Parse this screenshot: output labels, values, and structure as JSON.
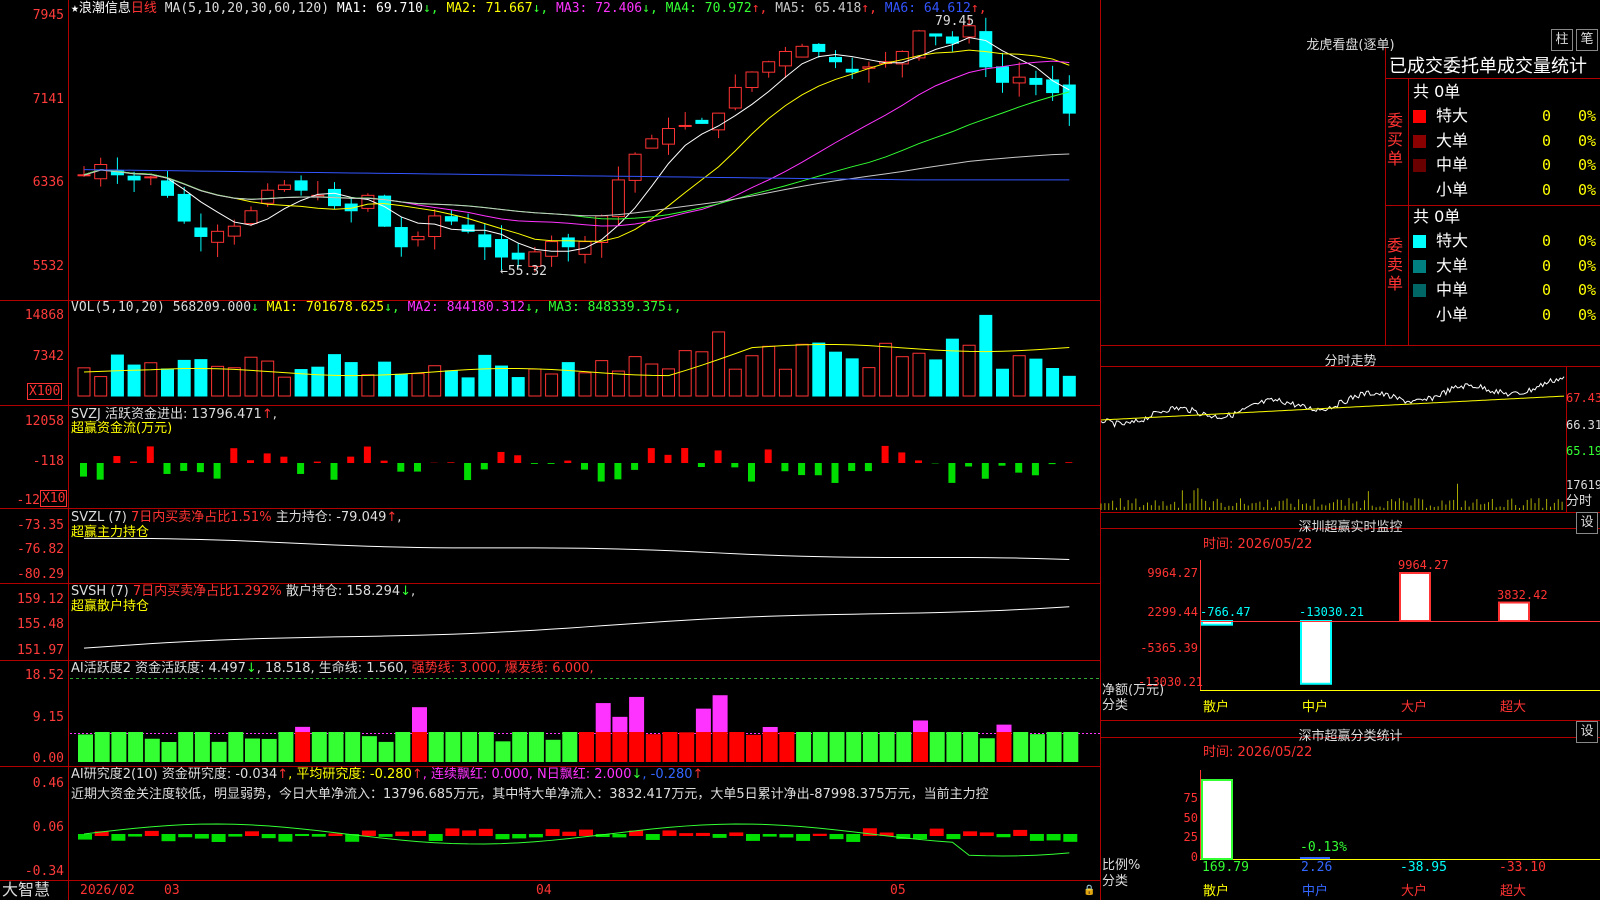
{
  "stock": {
    "star": "★",
    "name": "浪潮信息",
    "period": "日线"
  },
  "ma_header": {
    "spec": "MA(5,10,20,30,60,120)",
    "items": [
      {
        "label": "MA1:",
        "value": "69.710",
        "arrow": "↓",
        "color": "#ffffff"
      },
      {
        "label": "MA2:",
        "value": "71.667",
        "arrow": "↓",
        "color": "#ffff00"
      },
      {
        "label": "MA3:",
        "value": "72.406",
        "arrow": "↓",
        "color": "#ff33ff"
      },
      {
        "label": "MA4:",
        "value": "70.972",
        "arrow": "↑",
        "color": "#33ff33"
      },
      {
        "label": "MA5:",
        "value": "65.418",
        "arrow": "↑",
        "color": "#c8c8c8"
      },
      {
        "label": "MA6:",
        "value": "64.612",
        "arrow": "↑",
        "color": "#3355ff"
      }
    ]
  },
  "price_axis": [
    "7945",
    "7141",
    "6336",
    "5532"
  ],
  "price_high_label": "79.45",
  "price_low_label": "←55.32",
  "vol_header": {
    "spec": "VOL(5,10,20)",
    "value": "568209.000",
    "arrow": "↓",
    "items": [
      {
        "label": "MA1:",
        "value": "701678.625",
        "arrow": "↓",
        "color": "#ffff00"
      },
      {
        "label": "MA2:",
        "value": "844180.312",
        "arrow": "↓",
        "color": "#ff33ff"
      },
      {
        "label": "MA3:",
        "value": "848339.375",
        "arrow": "↓",
        "color": "#33ff33"
      }
    ]
  },
  "vol_axis": [
    "14868",
    "7342"
  ],
  "vol_unit": "X100",
  "svzj": {
    "line1": "SVZJ  活跃资金进出: 13796.471",
    "arrow": "↑",
    "tail": ",",
    "line2": "超赢资金流(万元)"
  },
  "svzj_axis": [
    "12058",
    "-118",
    "-12"
  ],
  "svzj_unit": "X10",
  "svzl": {
    "prefix": "SVZL (7) ",
    "red": "7日内买卖净占比1.51%",
    "mid": " 主力持仓: -79.049",
    "arrow": "↑",
    "tail": ",",
    "line2": "超赢主力持仓"
  },
  "svzl_axis": [
    "-73.35",
    "-76.82",
    "-80.29"
  ],
  "svsh": {
    "prefix": "SVSH (7) ",
    "red": "7日内买卖净占比1.292%",
    "mid": " 散户持仓: 158.294",
    "arrow": "↓",
    "tail": ",",
    "line2": "超赢散户持仓"
  },
  "svsh_axis": [
    "159.12",
    "155.48",
    "151.97"
  ],
  "ai1": {
    "prefix": "AI活跃度2 资金活跃度: 4.497",
    "a1": "↓",
    "mid": ", 18.518, 生命线: 1.560,",
    "red": " 强势线: 3.000, 爆发线: 6.000,"
  },
  "ai1_axis": [
    "18.52",
    "9.15",
    "0.00"
  ],
  "ai2": {
    "prefix": "AI研究度2(10) 资金研究度: -0.034",
    "a1": "↑",
    "avg": ", 平均研究度: -0.280",
    "a2": "↑",
    "red": ", 连续飘红: 0.000, N日飘红: 2.000",
    "a3": "↓",
    "blue": ", -0.280",
    "a4": "↑",
    "comment": "近期大资金关注度较低，明显弱势，今日大单净流入：13796.685万元，其中特大单净流入：3832.417万元，大单5日累计净出-87998.375万元，当前主力控"
  },
  "ai2_axis": [
    "0.46",
    "0.06",
    "-0.34"
  ],
  "date_axis": {
    "brand": "大智慧",
    "labels": [
      "2026/02",
      "03",
      "04",
      "05"
    ]
  },
  "right": {
    "lhb": {
      "title": "龙虎看盘(逐单)",
      "btn1": "柱",
      "btn2": "笔",
      "header": "已成交委托单成交量统计",
      "buy": {
        "side": "委买单",
        "total": "共 0单",
        "rows": [
          {
            "name": "特大",
            "count": "0",
            "pct": "0%",
            "color": "#ff0000"
          },
          {
            "name": "大单",
            "count": "0",
            "pct": "0%",
            "color": "#8b0000"
          },
          {
            "name": "中单",
            "count": "0",
            "pct": "0%",
            "color": "#6b0000"
          },
          {
            "name": "小单",
            "count": "0",
            "pct": "0%",
            "color": "#000000"
          }
        ]
      },
      "sell": {
        "side": "委卖单",
        "total": "共 0单",
        "rows": [
          {
            "name": "特大",
            "count": "0",
            "pct": "0%",
            "color": "#00ffff"
          },
          {
            "name": "大单",
            "count": "0",
            "pct": "0%",
            "color": "#008080"
          },
          {
            "name": "中单",
            "count": "0",
            "pct": "0%",
            "color": "#006666"
          },
          {
            "name": "小单",
            "count": "0",
            "pct": "0%",
            "color": "#000000"
          }
        ]
      }
    },
    "intraday": {
      "title": "分时走势",
      "axis": [
        "67.43",
        "66.31",
        "65.19"
      ],
      "vol": "17619",
      "vol_label": "分时"
    },
    "monitor": {
      "title": "深圳超赢实时监控",
      "btn": "设",
      "time": "时间: 2026/05/22",
      "axis": [
        "9964.27",
        "2299.44",
        "-5365.39",
        "-13030.21"
      ],
      "net_label": "净额(万元)",
      "cat_label": "分类",
      "bars": [
        {
          "cat": "散户",
          "value": -766.47,
          "label": "-766.47"
        },
        {
          "cat": "中户",
          "value": -13030.21,
          "label": "-13030.21"
        },
        {
          "cat": "大户",
          "value": 9964.27,
          "label": "9964.27"
        },
        {
          "cat": "超大",
          "value": 3832.42,
          "label": "3832.42"
        }
      ]
    },
    "stats": {
      "title": "深市超赢分类统计",
      "btn": "设",
      "time": "时间: 2026/05/22",
      "axis": [
        "75",
        "50",
        "25",
        "0"
      ],
      "ratio_label": "比例%",
      "cat_label": "分类",
      "top_label": "-0.13%",
      "cats": [
        {
          "cat": "散户",
          "value": "169.79",
          "color": "#33ff33"
        },
        {
          "cat": "中户",
          "value": "2.26",
          "color": "#3366ff"
        },
        {
          "cat": "大户",
          "value": "-38.95",
          "color": "#00ffff"
        },
        {
          "cat": "超大",
          "value": "-33.10",
          "color": "#ff3333"
        }
      ]
    }
  },
  "chart_data": {
    "type": "candlestick",
    "x_months": [
      "2026/02",
      "03",
      "04",
      "05"
    ],
    "price_range": [
      55.32,
      79.45
    ],
    "high": 79.45,
    "low": 55.32,
    "last_close": 69.7,
    "volume_last": 568209.0,
    "note": "values shown on price axis are in ×0.01 units"
  }
}
